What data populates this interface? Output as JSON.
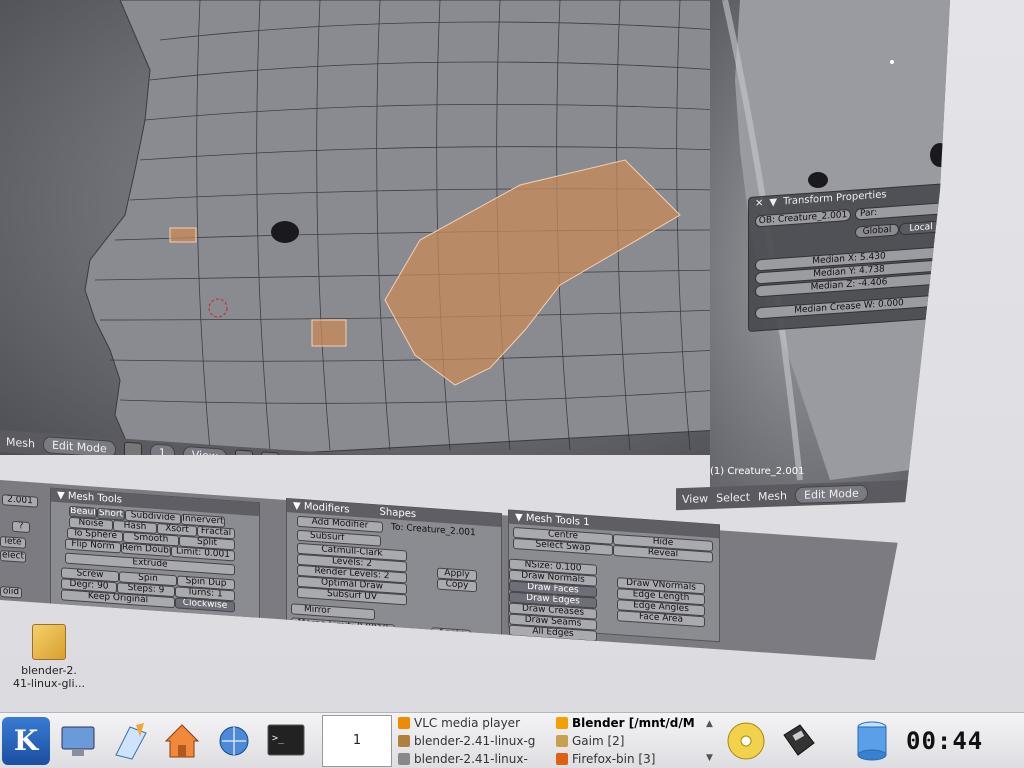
{
  "viewport": {
    "object_label": "(1) Creature_2.001",
    "main_header": {
      "label_left": "Mesh",
      "mode": "Edit Mode",
      "layer": "1",
      "view_menu": "View"
    },
    "side_header": {
      "view": "View",
      "select": "Select",
      "mesh": "Mesh",
      "mode": "Edit Mode"
    }
  },
  "transform_panel": {
    "title": "Transform Properties",
    "ob": "OB: Creature_2.001",
    "par": "Par:",
    "global": "Global",
    "local": "Local",
    "median_x": "Median X: 5.430",
    "median_y": "Median Y: 4.738",
    "median_z": "Median Z: -4.406",
    "median_crease": "Median Crease W: 0.000"
  },
  "buttons_window": {
    "left_value": "2.001",
    "left_buttons": [
      "?",
      "lete",
      "elect",
      "olid"
    ],
    "mesh_tools": {
      "title": "Mesh Tools",
      "row1": [
        "Beaul",
        "Short",
        "Subdivide",
        "Innervert"
      ],
      "row2": [
        "Noise",
        "Hash",
        "Xsort",
        "Fractal"
      ],
      "row3": [
        "To Sphere",
        "Smooth",
        "Split"
      ],
      "row4": [
        "Flip Norm",
        "Rem Doubl",
        "Limit: 0.001"
      ],
      "extrude": "Extrude",
      "row6": [
        "Screw",
        "Spin",
        "Spin Dup"
      ],
      "degr": "Degr: 90",
      "steps": "Steps: 9",
      "turns": "Turns: 1",
      "keep_original": "Keep Original",
      "clockwise": "Clockwise",
      "extrude_dup": "Extrude Dup",
      "offset": "Offset: 1.00"
    },
    "modifiers": {
      "tab_modifiers": "Modifiers",
      "tab_shapes": "Shapes",
      "add_modifier": "Add Modifier",
      "to": "To: Creature_2.001",
      "subsurf_name": "Subsurf",
      "catmull": "Catmull-Clark",
      "levels": "Levels: 2",
      "render_levels": "Render Levels: 2",
      "optimal_draw": "Optimal Draw",
      "subsurf_uv": "Subsurf UV",
      "apply": "Apply",
      "copy": "Copy",
      "mirror_name": "Mirror",
      "merge_limit": "Merge Limit: 0.0010",
      "apply2": "Apply"
    },
    "mesh_tools_1": {
      "title": "Mesh Tools 1",
      "centre": "Centre",
      "hide": "Hide",
      "select_swap": "Select Swap",
      "reveal": "Reveal",
      "nsize": "NSize: 0.100",
      "draw_normals": "Draw Normals",
      "draw_vnormals": "Draw VNormals",
      "draw_faces": "Draw Faces",
      "edge_length": "Edge Length",
      "draw_edges": "Draw Edges",
      "edge_angles": "Edge Angles",
      "draw_creases": "Draw Creases",
      "face_area": "Face Area",
      "draw_seams": "Draw Seams",
      "all_edges": "All Edges"
    }
  },
  "desktop_icon": {
    "label_line1": "blender-2.",
    "label_line2": "41-linux-gli..."
  },
  "taskbar": {
    "pager": "1",
    "tasks": [
      {
        "label": "VLC media player",
        "color": "#f08a00",
        "active": false
      },
      {
        "label": "Blender [/mnt/d/M",
        "color": "#f4a000",
        "active": true
      },
      {
        "label": "blender-2.41-linux-g",
        "color": "#b08040",
        "active": false
      },
      {
        "label": "Gaim [2]",
        "color": "#c8a050",
        "active": false
      },
      {
        "label": "blender-2.41-linux-",
        "color": "#888888",
        "active": false
      },
      {
        "label": "Firefox-bin [3]",
        "color": "#e06010",
        "active": false
      }
    ],
    "clock": "00:44"
  }
}
